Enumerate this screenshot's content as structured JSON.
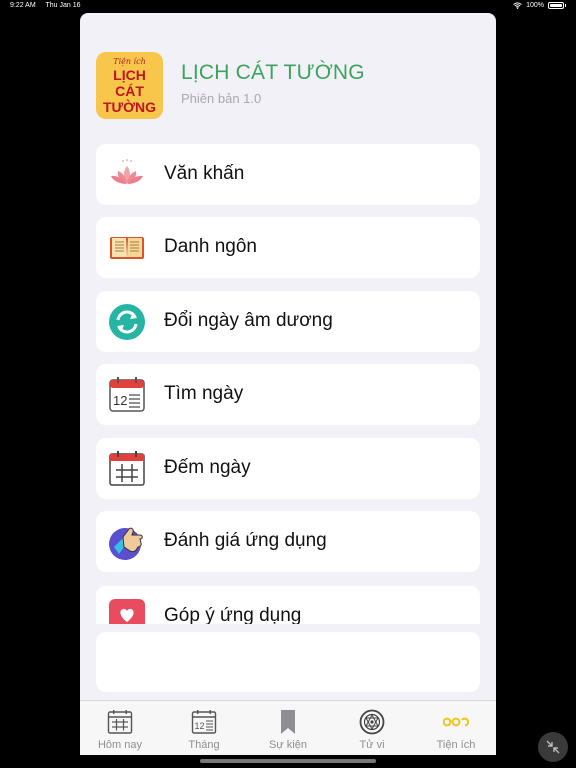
{
  "status_bar": {
    "time": "9:22 AM",
    "date": "Thu Jan 16",
    "battery": "100%"
  },
  "header": {
    "logo": {
      "line1": "Tiện ích",
      "line2": "LỊCH",
      "line3": "CÁT",
      "line4": "TƯỜNG"
    },
    "title": "LỊCH CÁT TƯỜNG",
    "version": "Phiên bản 1.0"
  },
  "menu": {
    "items": [
      {
        "label": "Văn khấn",
        "icon": "lotus-icon"
      },
      {
        "label": "Danh ngôn",
        "icon": "book-icon"
      },
      {
        "label": "Đổi ngày âm dương",
        "icon": "convert-icon"
      },
      {
        "label": "Tìm ngày",
        "icon": "calendar-icon"
      },
      {
        "label": "Đếm ngày",
        "icon": "calendar-grid-icon"
      },
      {
        "label": "Đánh giá ứng dụng",
        "icon": "thumbs-up-icon"
      },
      {
        "label": "Góp ý ứng dụng",
        "icon": "heart-icon"
      }
    ]
  },
  "tabbar": {
    "tabs": [
      {
        "label": "Hôm nay",
        "icon": "calendar-grid-icon"
      },
      {
        "label": "Tháng",
        "icon": "calendar-icon"
      },
      {
        "label": "Sự kiện",
        "icon": "bookmark-icon"
      },
      {
        "label": "Tử vi",
        "icon": "zodiac-icon"
      },
      {
        "label": "Tiện ích",
        "icon": "more-icon",
        "active": true
      }
    ],
    "active_color": "#f0c419",
    "inactive_color": "#8e8e93"
  }
}
